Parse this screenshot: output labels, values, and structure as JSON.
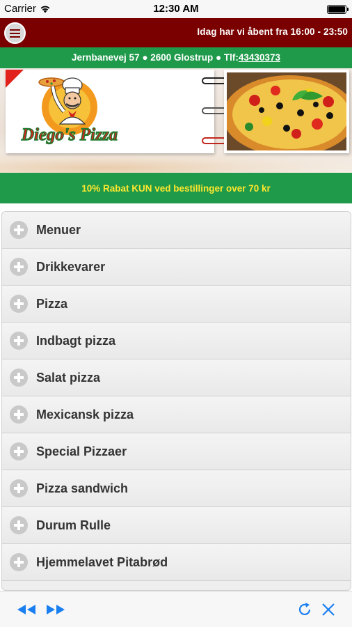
{
  "status_bar": {
    "carrier": "Carrier",
    "time": "12:30 AM"
  },
  "header": {
    "opening_hours": "Idag har vi åbent fra 16:00 - 23:50"
  },
  "address_bar": {
    "address": "Jernbanevej 57 ● 2600 Glostrup ● Tlf:",
    "phone": "43430373"
  },
  "banner": {
    "logo_text": "Diego's Pizza"
  },
  "promo": {
    "text": "10% Rabat KUN ved bestillinger over 70 kr"
  },
  "menu": {
    "items": [
      {
        "label": "Menuer"
      },
      {
        "label": "Drikkevarer"
      },
      {
        "label": "Pizza"
      },
      {
        "label": "Indbagt pizza"
      },
      {
        "label": "Salat pizza"
      },
      {
        "label": "Mexicansk pizza"
      },
      {
        "label": "Special Pizzaer"
      },
      {
        "label": "Pizza sandwich"
      },
      {
        "label": "Durum Rulle"
      },
      {
        "label": "Hjemmelavet Pitabrød"
      }
    ]
  },
  "colors": {
    "header_red": "#7a0000",
    "green": "#1f9a4a",
    "promo_yellow": "#ffe72e",
    "toolbar_blue": "#1a7ff0"
  },
  "toolbar": {
    "icons": [
      "rewind-icon",
      "fast-forward-icon",
      "refresh-icon",
      "close-icon"
    ]
  }
}
